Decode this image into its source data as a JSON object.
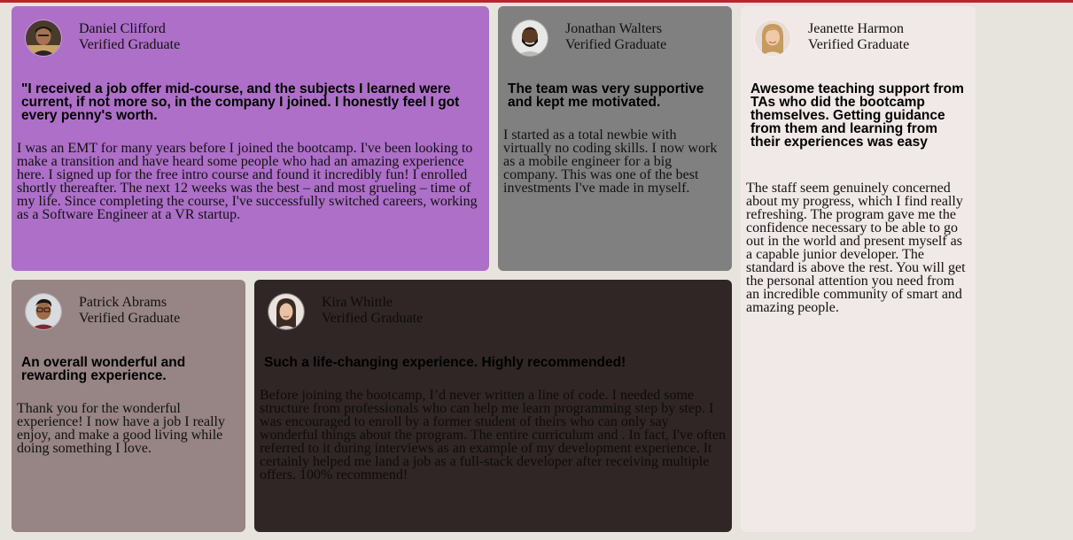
{
  "testimonials": [
    {
      "name": "Daniel Clifford",
      "role": "Verified Graduate",
      "headline": "\"I received a job offer mid-course, and the subjects I learned were current, if not more so, in the company I joined. I honestly feel I got every penny's worth.",
      "body": "I was an EMT for many years before I joined the bootcamp. I've been looking to make a transition and have heard some people who had an amazing experience here. I signed up for the free intro course and found it incredibly fun! I enrolled shortly thereafter. The next 12 weeks was the best – and most grueling – time of my life. Since completing the course, I've successfully switched careers, working as a Software Engineer at a VR startup.",
      "color": "#ad6fc8"
    },
    {
      "name": "Jonathan Walters",
      "role": "Verified Graduate",
      "headline": "The team was very supportive and kept me motivated.",
      "body": "I started as a total newbie with virtually no coding skills. I now work as a mobile engineer for a big company. This was one of the best investments I've made in myself.",
      "color": "#808080"
    },
    {
      "name": "Jeanette Harmon",
      "role": "Verified Graduate",
      "headline": "Awesome teaching support from TAs who did the bootcamp themselves. Getting guidance from them and learning from their experiences was easy",
      "body": "The staff seem genuinely concerned about my progress, which I find really refreshing. The program gave me the confidence necessary to be able to go out in the world and present myself as a capable junior developer. The standard is above the rest. You will get the personal attention you need from an incredible community of smart and amazing people.",
      "color": "#f1e9e7"
    },
    {
      "name": "Patrick Abrams",
      "role": "Verified Graduate",
      "headline": "An overall wonderful and rewarding experience.",
      "body": "Thank you for the wonderful experience! I now have a job I really enjoy, and make a good living while doing something I love.",
      "color": "#978484"
    },
    {
      "name": "Kira Whittle",
      "role": "Verified Graduate",
      "headline": "Such a life-changing experience. Highly recommended!",
      "body": "Before joining the bootcamp, I’d never written a line of code. I needed some structure from professionals who can help me learn programming step by step. I was encouraged to enroll by a former student of theirs who can only say wonderful things about the program. The entire curriculum and . In fact, I've often referred to it during interviews as an example of my development experience. It certainly helped me land a job as a full-stack developer after receiving multiple offers. 100% recommend!",
      "color": "#302626"
    }
  ],
  "colors": {
    "page_background": "#e6e4dd",
    "accent_bar": "#b7262f"
  },
  "icons": {
    "avatar": "avatar-photo"
  }
}
